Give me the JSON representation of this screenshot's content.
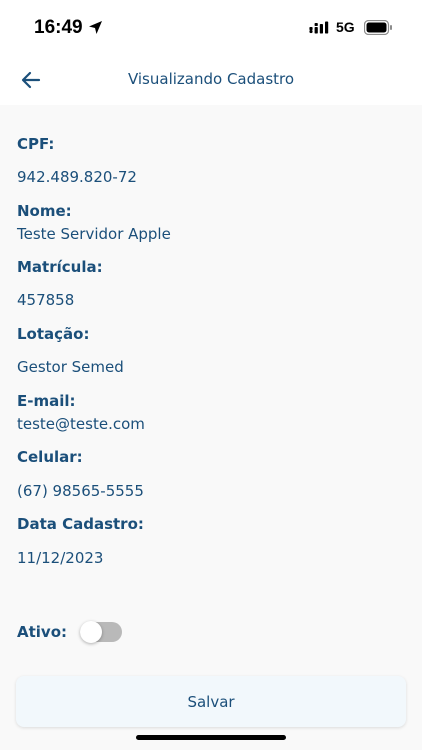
{
  "status_bar": {
    "time": "16:49",
    "network": "5G",
    "icons": [
      "location-arrow-icon",
      "signal-icon",
      "battery-icon"
    ]
  },
  "header": {
    "title": "Visualizando Cadastro",
    "back_icon": "arrow-left-icon"
  },
  "fields": {
    "cpf": {
      "label": "CPF:",
      "value": "942.489.820-72"
    },
    "nome": {
      "label": "Nome:",
      "value": "Teste Servidor Apple"
    },
    "matricula": {
      "label": "Matrícula:",
      "value": "457858"
    },
    "lotacao": {
      "label": "Lotação:",
      "value": "Gestor Semed"
    },
    "email": {
      "label": "E-mail:",
      "value": "teste@teste.com"
    },
    "celular": {
      "label": "Celular:",
      "value": "(67) 98565-5555"
    },
    "data_cadastro": {
      "label": "Data Cadastro:",
      "value": "11/12/2023"
    }
  },
  "ativo": {
    "label": "Ativo:",
    "enabled": false
  },
  "save_label": "Salvar",
  "colors": {
    "primary": "#1b4f7a",
    "background": "#f9f9f9",
    "toggle_off": "#b9b9b9",
    "button_bg": "#f2f8fc"
  }
}
